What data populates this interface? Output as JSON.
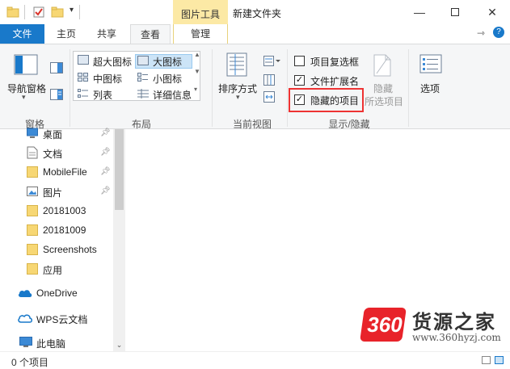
{
  "window": {
    "context_tab_label": "图片工具",
    "title": "新建文件夹"
  },
  "tabs": {
    "file": "文件",
    "home": "主页",
    "share": "共享",
    "view": "查看",
    "manage": "管理"
  },
  "ribbon": {
    "panes": {
      "nav_pane": "导航窗格",
      "group_label": "窗格"
    },
    "layout": {
      "items": [
        "超大图标",
        "大图标",
        "中图标",
        "小图标",
        "列表",
        "详细信息"
      ],
      "selected": "大图标",
      "group_label": "布局"
    },
    "current_view": {
      "sort_by": "排序方式",
      "group_label": "当前视图"
    },
    "show_hide": {
      "item_checkboxes": {
        "label": "项目复选框",
        "checked": false
      },
      "file_extensions": {
        "label": "文件扩展名",
        "checked": true
      },
      "hidden_items": {
        "label": "隐藏的项目",
        "checked": true
      },
      "hide_selected_line1": "隐藏",
      "hide_selected_line2": "所选项目",
      "group_label": "显示/隐藏"
    },
    "options": "选项"
  },
  "nav": {
    "items": [
      {
        "label": "桌面",
        "icon": "desktop-icon",
        "pinned": true
      },
      {
        "label": "文档",
        "icon": "document-icon",
        "pinned": true
      },
      {
        "label": "MobileFile",
        "icon": "folder-icon",
        "pinned": true
      },
      {
        "label": "图片",
        "icon": "picture-icon",
        "pinned": true
      },
      {
        "label": "20181003",
        "icon": "folder-icon",
        "pinned": false
      },
      {
        "label": "20181009",
        "icon": "folder-icon",
        "pinned": false
      },
      {
        "label": "Screenshots",
        "icon": "folder-icon",
        "pinned": false
      },
      {
        "label": "应用",
        "icon": "folder-icon",
        "pinned": false
      },
      {
        "label": "OneDrive",
        "icon": "cloud-icon",
        "pinned": false
      },
      {
        "label": "WPS云文档",
        "icon": "wps-cloud-icon",
        "pinned": false
      },
      {
        "label": "此电脑",
        "icon": "computer-icon",
        "pinned": false
      }
    ]
  },
  "status": {
    "item_count": "0 个项目"
  },
  "watermark": {
    "brand_number": "360",
    "brand_name": "货源之家",
    "url": "www.360hyzj.com"
  },
  "colors": {
    "file_tab": "#1979ca",
    "context_tab": "#fce9a5",
    "highlight": "#e33333",
    "selection": "#cce4f7"
  }
}
